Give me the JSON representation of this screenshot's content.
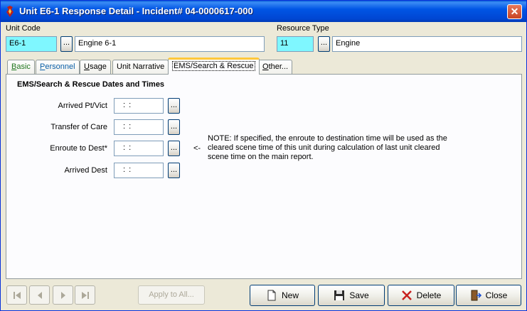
{
  "window": {
    "title": "Unit E6-1 Response Detail - Incident# 04-0000617-000",
    "close_glyph": "✕"
  },
  "unit": {
    "code_label": "Unit Code",
    "code_value": "E6-1",
    "name_value": "Engine 6-1",
    "lookup_label": "..."
  },
  "resource": {
    "type_label": "Resource Type",
    "type_code": "11",
    "type_name": "Engine",
    "lookup_label": "..."
  },
  "tabs": [
    {
      "label": "Basic",
      "underline": "B",
      "rest": "asic"
    },
    {
      "label": "Personnel",
      "underline": "P",
      "rest": "ersonnel"
    },
    {
      "label": "Usage",
      "underline": "U",
      "rest": "sage"
    },
    {
      "label": "Unit Narrative",
      "underline": "",
      "rest": "Unit Narrative"
    },
    {
      "label": "EMS/Search & Rescue",
      "underline": "",
      "rest": "EMS/Search & Rescue"
    },
    {
      "label": "Other...",
      "underline": "O",
      "rest": "ther..."
    }
  ],
  "active_tab": "EMS/Search & Rescue",
  "section": {
    "title": "EMS/Search & Rescue Dates and Times",
    "rows": [
      {
        "label": "Arrived Pt/Vict",
        "value": ": :",
        "button": "..."
      },
      {
        "label": "Transfer of Care",
        "value": ": :",
        "button": "..."
      },
      {
        "label": "Enroute to Dest*",
        "value": ": :",
        "button": "..."
      },
      {
        "label": "Arrived Dest",
        "value": ": :",
        "button": "..."
      }
    ],
    "arrow": "<-",
    "note": "NOTE: If specified, the enroute to destination time will be used as the cleared scene time of this unit during calculation of last unit cleared scene time on the main report."
  },
  "footer": {
    "nav": [
      "first-record",
      "previous-record",
      "next-record",
      "last-record"
    ],
    "apply_label": "Apply to All...",
    "new_label": "New",
    "save_label": "Save",
    "delete_label": "Delete",
    "close_label": "Close"
  }
}
